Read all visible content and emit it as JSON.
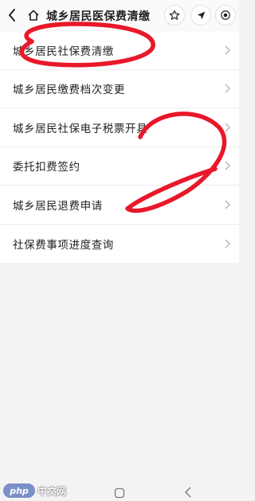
{
  "header": {
    "title": "城乡居民医保费清缴",
    "icons": [
      "back-icon",
      "home-icon",
      "star-icon",
      "location-arrow-icon",
      "record-icon"
    ]
  },
  "menu": {
    "items": [
      {
        "label": "城乡居民社保费清缴"
      },
      {
        "label": "城乡居民缴费档次变更"
      },
      {
        "label": "城乡居民社保电子税票开具"
      },
      {
        "label": "委托扣费签约"
      },
      {
        "label": "城乡居民退费申请"
      },
      {
        "label": "社保费事项进度查询"
      }
    ]
  },
  "annotation": {
    "marker_color": "#e8182a",
    "drawn_text": "2"
  },
  "watermark": {
    "logo": "php",
    "text": "中文网"
  },
  "nav": {
    "icons": [
      "home-square-icon",
      "back-chevron-icon"
    ]
  }
}
